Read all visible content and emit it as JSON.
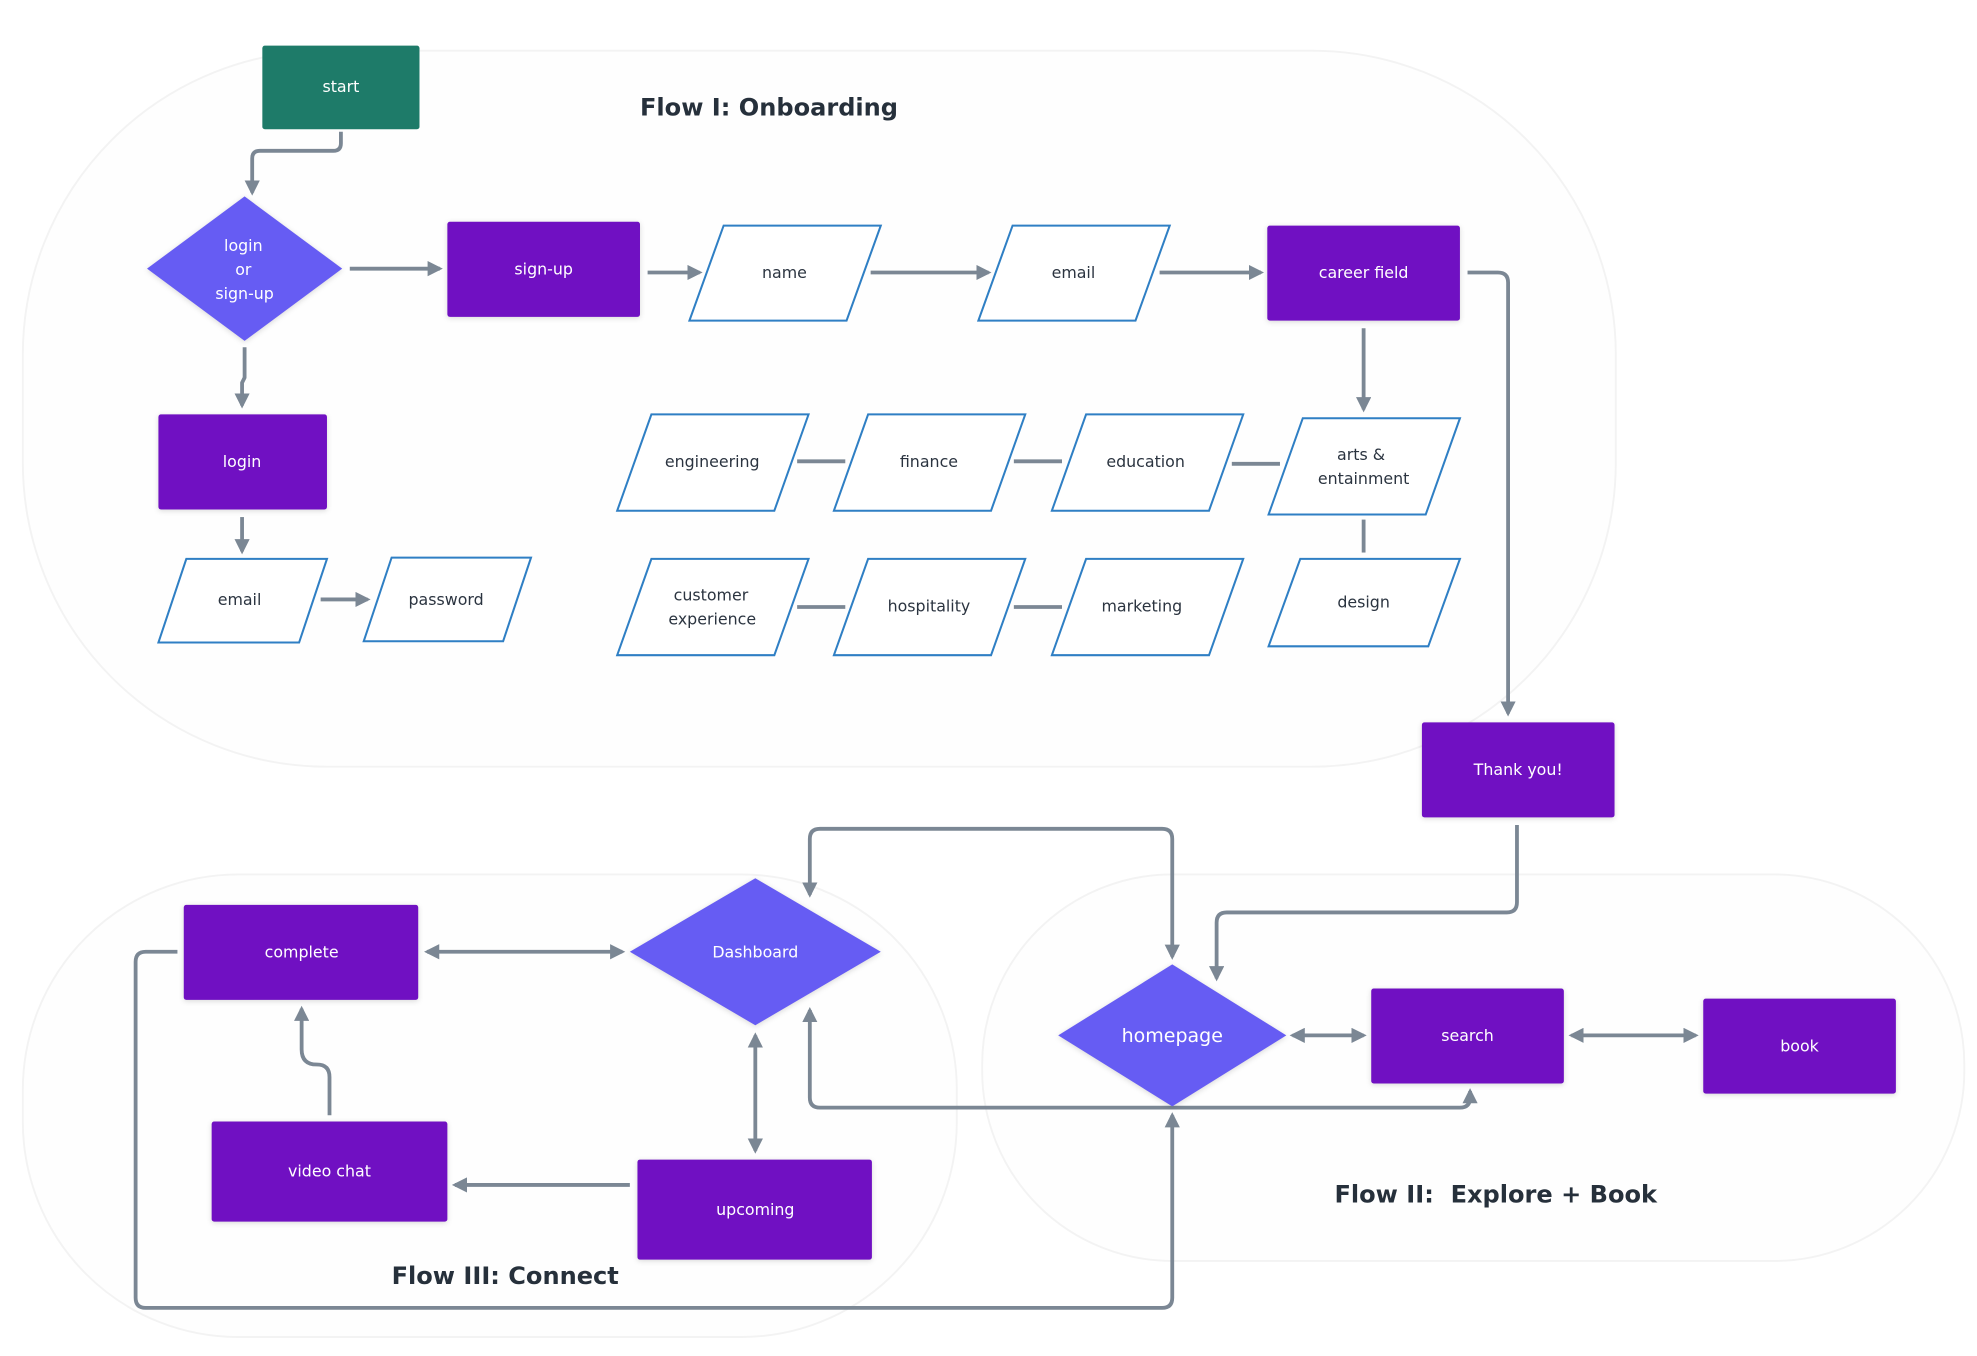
{
  "colors": {
    "process": "#7010c2",
    "decision": "#665cf3",
    "start": "#1e7b69",
    "input_border": "#2f7fc4",
    "connector": "#7b8794",
    "title": "#26303b"
  },
  "titles": {
    "flow1": "Flow I: Onboarding",
    "flow2": "Flow II:  Explore + Book",
    "flow3": "Flow III: Connect"
  },
  "nodes": {
    "start": "start",
    "login_or_signup": [
      "login",
      "or",
      "sign-up"
    ],
    "signup": "sign-up",
    "name": "name",
    "email_signup": "email",
    "career_field": "career field",
    "login": "login",
    "email_login": "email",
    "password": "password",
    "careers": {
      "engineering": "engineering",
      "finance": "finance",
      "education": "education",
      "arts": [
        "arts &",
        "entainment"
      ],
      "customer_experience": [
        "customer",
        "experience"
      ],
      "hospitality": "hospitality",
      "marketing": "marketing",
      "design": "design"
    },
    "thank_you": "Thank you!",
    "dashboard": "Dashboard",
    "homepage": "homepage",
    "search": "search",
    "book": "book",
    "complete": "complete",
    "video_chat": "video chat",
    "upcoming": "upcoming"
  }
}
